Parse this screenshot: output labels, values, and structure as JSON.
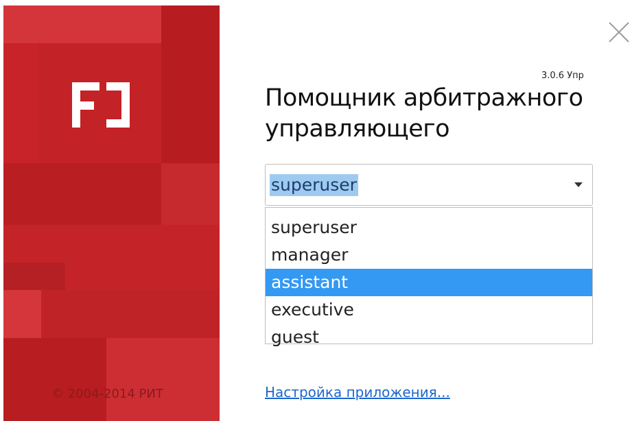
{
  "brand": {
    "logo_text": "F1",
    "copyright": "© 2004-2014 РИТ",
    "color": "#c9232a"
  },
  "window": {
    "close_icon": "close-icon",
    "version": "3.0.6 Упр",
    "title_line1": "Помощник арбитражного",
    "title_line2": "управляющего"
  },
  "login": {
    "selected_user": "superuser",
    "options": [
      "superuser",
      "manager",
      "assistant",
      "executive",
      "guest"
    ],
    "highlighted_index": 2
  },
  "settings_link": "Настройка приложения..."
}
